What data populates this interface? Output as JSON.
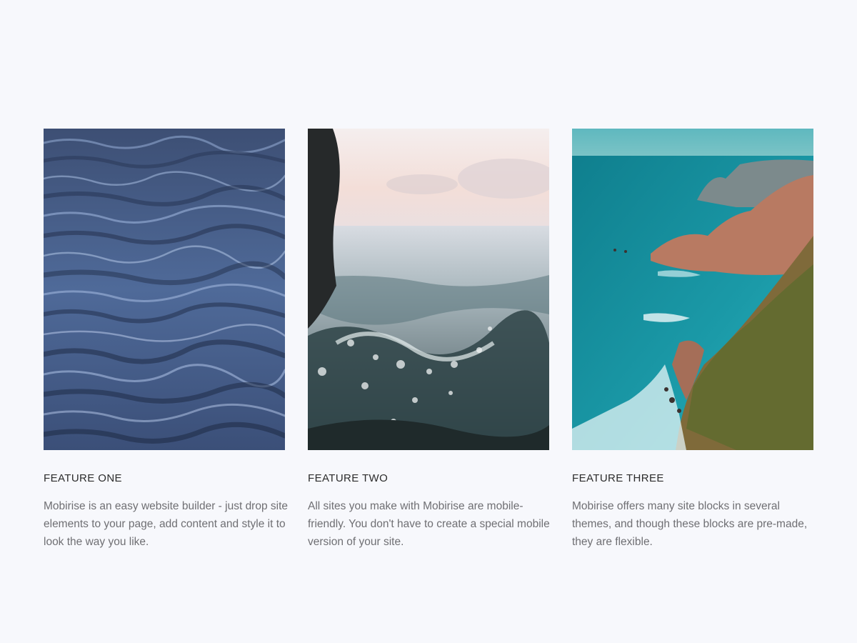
{
  "features": [
    {
      "title": "FEATURE ONE",
      "text": "Mobirise is an easy website builder - just drop site elements to your page, add content and style it to look the way you like.",
      "image": "ocean-waves-photo"
    },
    {
      "title": "FEATURE TWO",
      "text": "All sites you make with Mobirise are mobile-friendly. You don't have to create a special mobile version of your site.",
      "image": "wave-splash-sunset-photo"
    },
    {
      "title": "FEATURE THREE",
      "text": "Mobirise offers many site blocks in several themes, and though these blocks are pre-made, they are flexible.",
      "image": "coastal-cliffs-photo"
    }
  ],
  "colors": {
    "background": "#f7f8fc",
    "title": "#2b2b2b",
    "body_text": "#6f6f73"
  }
}
